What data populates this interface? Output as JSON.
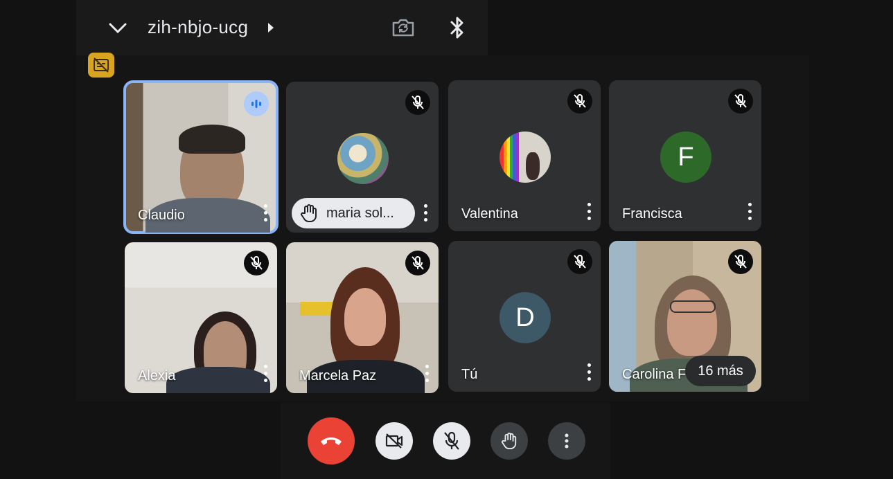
{
  "header": {
    "meeting_code": "zih-nbjo-ucg"
  },
  "icons": {
    "collapse": "chevron-down-icon",
    "code_arrow": "play-arrow-icon",
    "switch_camera": "camera-switch-icon",
    "bluetooth": "bluetooth-icon",
    "captions_off": "captions-off-icon"
  },
  "participants": [
    {
      "name": "Claudio",
      "state": "speaking",
      "media": "video"
    },
    {
      "name": "maria sol...",
      "state": "muted",
      "media": "avatar-photo",
      "hand_raised": true
    },
    {
      "name": "Valentina",
      "state": "muted",
      "media": "avatar-photo"
    },
    {
      "name": "Francisca",
      "state": "muted",
      "media": "avatar-letter",
      "initial": "F",
      "avatar_color": "#2d6a2a"
    },
    {
      "name": "Alexia",
      "state": "muted",
      "media": "video"
    },
    {
      "name": "Marcela Paz",
      "state": "muted",
      "media": "video"
    },
    {
      "name": "Tú",
      "state": "muted",
      "media": "avatar-letter",
      "initial": "D",
      "avatar_color": "#3d5866"
    },
    {
      "name": "Carolina F",
      "state": "muted",
      "media": "video"
    }
  ],
  "overflow_label": "16 más",
  "controls": {
    "end_call": "end-call-icon",
    "camera": "camera-off-icon",
    "mic": "mic-off-icon",
    "raise_hand": "raise-hand-icon",
    "more": "more-vertical-icon"
  },
  "colors": {
    "background": "#121212",
    "tile": "#2f3032",
    "active_outline": "#8ab4f8",
    "end_call": "#ea4335",
    "captions_badge": "#d9a520"
  }
}
